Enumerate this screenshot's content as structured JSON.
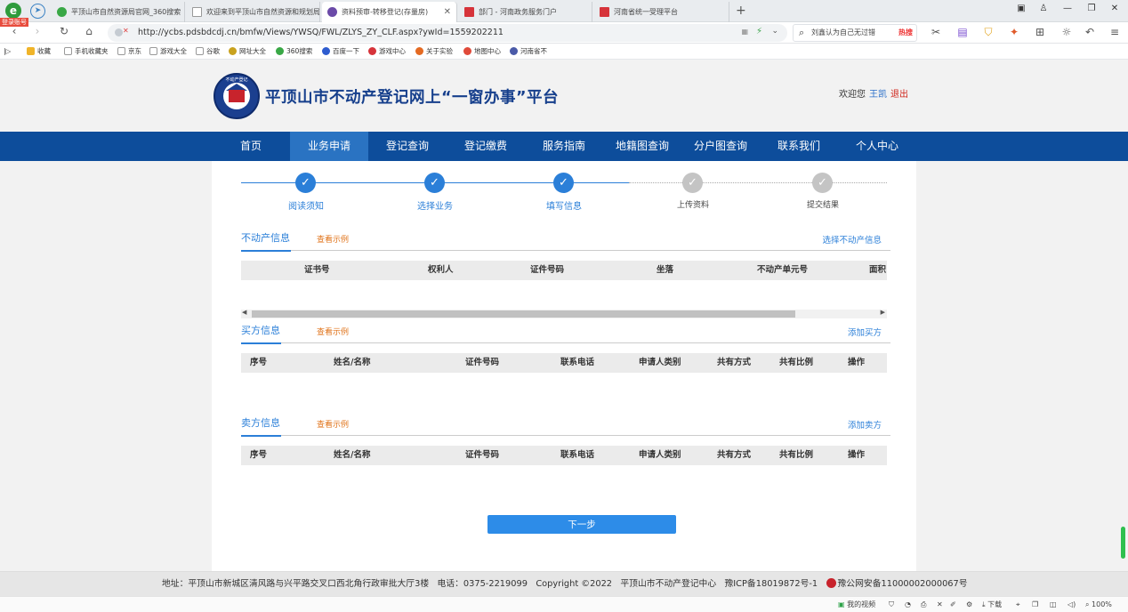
{
  "browser": {
    "brand_icon": "360-browser-icon",
    "login_badge": "登录账号",
    "tabs": [
      {
        "label": "平顶山市自然资源局官网_360搜索",
        "favicon": "search-360-icon"
      },
      {
        "label": "欢迎来到平顶山市自然资源和规划局",
        "favicon": "page-icon"
      },
      {
        "label": "资料预审-转移登记(存量房)",
        "favicon": "page-icon"
      },
      {
        "label": "部门 - 河南政务服务门户",
        "favicon": "henan-gov-icon"
      },
      {
        "label": "河南省统一受理平台",
        "favicon": "henan-gov-icon"
      }
    ],
    "new_tab": "+",
    "url": "http://ycbs.pdsbdcdj.cn/bmfw/Views/YWSQ/FWL/ZLYS_ZY_CLF.aspx?ywId=1559202211",
    "search_placeholder": "刘鑫认为自己无过错",
    "search_hot": "热搜",
    "bookmarks": [
      "收藏",
      "手机收藏夹",
      "京东",
      "游戏大全",
      "谷歌",
      "网址大全",
      "360搜索",
      "百度一下",
      "游戏中心",
      "关于实验",
      "地图中心",
      "河南省不"
    ],
    "status": {
      "video": "我的视频",
      "download": "下载",
      "zoom": "100%"
    }
  },
  "header": {
    "emblem_text": "不动产登记",
    "title": "平顶山市不动产登记网上“一窗办事”平台",
    "welcome": "欢迎您",
    "user": "王凯",
    "logout": "退出"
  },
  "nav": [
    {
      "label": "首页",
      "active": false
    },
    {
      "label": "业务申请",
      "active": true
    },
    {
      "label": "登记查询",
      "active": false
    },
    {
      "label": "登记缴费",
      "active": false
    },
    {
      "label": "服务指南",
      "active": false
    },
    {
      "label": "地籍图查询",
      "active": false
    },
    {
      "label": "分户图查询",
      "active": false
    },
    {
      "label": "联系我们",
      "active": false
    },
    {
      "label": "个人中心",
      "active": false
    }
  ],
  "steps": [
    {
      "label": "阅读须知",
      "done": true
    },
    {
      "label": "选择业务",
      "done": true
    },
    {
      "label": "填写信息",
      "done": true
    },
    {
      "label": "上传资料",
      "done": false
    },
    {
      "label": "提交结果",
      "done": false
    }
  ],
  "property_section": {
    "title": "不动产信息",
    "example": "查看示例",
    "action": "选择不动产信息",
    "columns": [
      "证书号",
      "权利人",
      "证件号码",
      "坐落",
      "不动产单元号",
      "面积"
    ]
  },
  "buyer_section": {
    "title": "买方信息",
    "example": "查看示例",
    "action": "添加买方",
    "columns": [
      "序号",
      "姓名/名称",
      "证件号码",
      "联系电话",
      "申请人类别",
      "共有方式",
      "共有比例",
      "操作"
    ]
  },
  "seller_section": {
    "title": "卖方信息",
    "example": "查看示例",
    "action": "添加卖方",
    "columns": [
      "序号",
      "姓名/名称",
      "证件号码",
      "联系电话",
      "申请人类别",
      "共有方式",
      "共有比例",
      "操作"
    ]
  },
  "next_button": "下一步",
  "footer": {
    "address": "地址：平顶山市新城区清风路与兴平路交叉口西北角行政审批大厅3楼",
    "phone": "电话：0375-2219099",
    "copyright": "Copyright ©2022",
    "center": "平顶山市不动产登记中心",
    "icp": "豫ICP备18019872号-1",
    "police": "豫公网安备11000002000067号"
  },
  "colors": {
    "nav_bg": "#0d4d9b",
    "nav_active": "#2a73c2",
    "accent": "#2b7fd8",
    "example_link": "#e0731a",
    "logout": "#d0261c"
  }
}
